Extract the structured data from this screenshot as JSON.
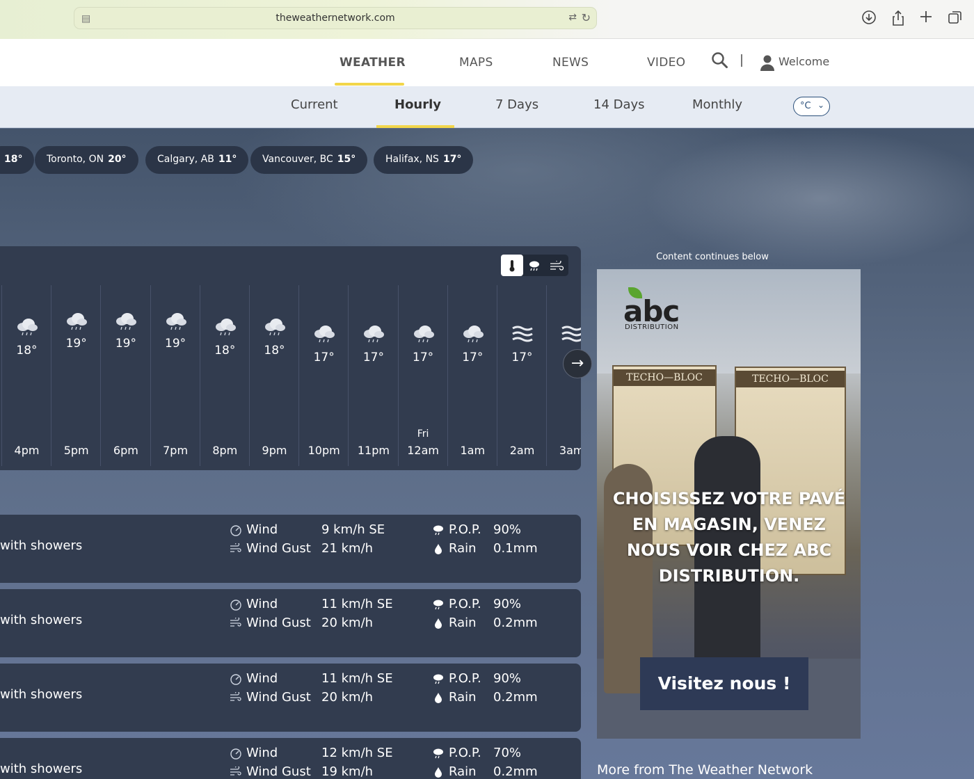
{
  "browser": {
    "url": "theweathernetwork.com",
    "icons": [
      "tabs-icon",
      "translate-icon",
      "reload-icon",
      "download-icon",
      "share-icon",
      "new-tab-icon",
      "tab-overview-icon"
    ]
  },
  "main_nav": {
    "items": [
      {
        "label": "WEATHER",
        "active": true
      },
      {
        "label": "MAPS"
      },
      {
        "label": "NEWS"
      },
      {
        "label": "VIDEO"
      }
    ],
    "welcome": "Welcome",
    "accent": "#f2d64a"
  },
  "sub_nav": {
    "items": [
      {
        "label": "Current"
      },
      {
        "label": "Hourly",
        "active": true
      },
      {
        "label": "7 Days"
      },
      {
        "label": "14 Days"
      },
      {
        "label": "Monthly"
      }
    ],
    "unit": "°C"
  },
  "cities": [
    {
      "name": "",
      "temp": "18°"
    },
    {
      "name": "Toronto, ON",
      "temp": "20°"
    },
    {
      "name": "Calgary, AB",
      "temp": "11°"
    },
    {
      "name": "Vancouver, BC",
      "temp": "15°"
    },
    {
      "name": "Halifax, NS",
      "temp": "17°"
    }
  ],
  "hourly": {
    "toggle": [
      "thermometer-icon",
      "rain-cloud-icon",
      "wind-icon"
    ],
    "hours": [
      {
        "time": "4pm",
        "temp": "18°",
        "icon": "rain-cloud-icon",
        "day": ""
      },
      {
        "time": "5pm",
        "temp": "19°",
        "icon": "rain-cloud-icon",
        "day": ""
      },
      {
        "time": "6pm",
        "temp": "19°",
        "icon": "rain-cloud-icon",
        "day": ""
      },
      {
        "time": "7pm",
        "temp": "19°",
        "icon": "rain-cloud-icon",
        "day": ""
      },
      {
        "time": "8pm",
        "temp": "18°",
        "icon": "rain-cloud-icon",
        "day": ""
      },
      {
        "time": "9pm",
        "temp": "18°",
        "icon": "rain-cloud-icon",
        "day": ""
      },
      {
        "time": "10pm",
        "temp": "17°",
        "icon": "rain-cloud-icon",
        "day": ""
      },
      {
        "time": "11pm",
        "temp": "17°",
        "icon": "rain-cloud-icon",
        "day": ""
      },
      {
        "time": "12am",
        "temp": "17°",
        "icon": "rain-cloud-icon",
        "day": "Fri"
      },
      {
        "time": "1am",
        "temp": "17°",
        "icon": "rain-cloud-icon",
        "day": ""
      },
      {
        "time": "2am",
        "temp": "17°",
        "icon": "fog-icon",
        "day": ""
      },
      {
        "time": "3am",
        "temp": "",
        "icon": "fog-icon",
        "day": ""
      }
    ]
  },
  "details": [
    {
      "condition": "with showers",
      "wind_label": "Wind",
      "wind": "9 km/h SE",
      "gust_label": "Wind Gust",
      "gust": "21 km/h",
      "pop_label": "P.O.P.",
      "pop": "90%",
      "rain_label": "Rain",
      "rain": "0.1mm"
    },
    {
      "condition": "with showers",
      "wind_label": "Wind",
      "wind": "11 km/h SE",
      "gust_label": "Wind Gust",
      "gust": "20 km/h",
      "pop_label": "P.O.P.",
      "pop": "90%",
      "rain_label": "Rain",
      "rain": "0.2mm"
    },
    {
      "condition": "with showers",
      "wind_label": "Wind",
      "wind": "11 km/h SE",
      "gust_label": "Wind Gust",
      "gust": "20 km/h",
      "pop_label": "P.O.P.",
      "pop": "90%",
      "rain_label": "Rain",
      "rain": "0.2mm"
    },
    {
      "condition": "with showers",
      "wind_label": "Wind",
      "wind": "12 km/h SE",
      "gust_label": "Wind Gust",
      "gust": "19 km/h",
      "pop_label": "P.O.P.",
      "pop": "70%",
      "rain_label": "Rain",
      "rain": "0.2mm"
    }
  ],
  "ad": {
    "label": "Content continues below",
    "logo": "abc",
    "logo_sub": "DISTRIBUTION",
    "pallet_brand": "TECHO—BLOC",
    "headline": "CHOISISSEZ VOTRE PAVÉ EN MAGASIN, VENEZ NOUS VOIR CHEZ ABC DISTRIBUTION.",
    "cta": "Visitez nous !"
  },
  "more_heading": "More from The Weather Network"
}
